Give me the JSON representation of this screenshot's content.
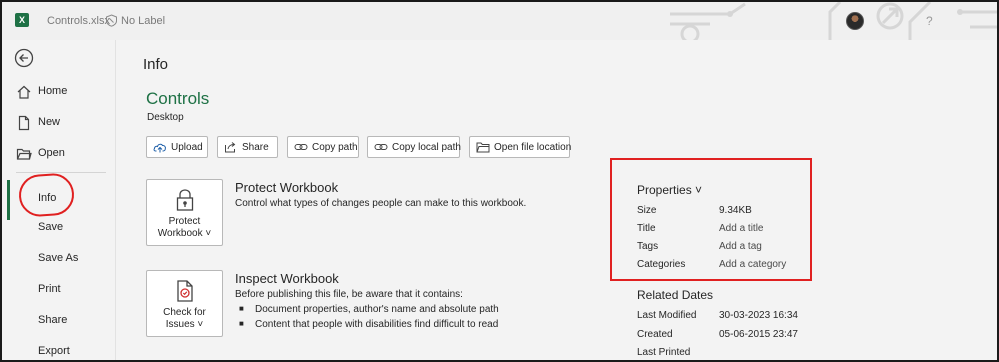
{
  "titlebar": {
    "file_name": "Controls.xlsx",
    "sensitivity_label": "No Label",
    "help": "?"
  },
  "sidebar": {
    "items": [
      {
        "label": "Home"
      },
      {
        "label": "New"
      },
      {
        "label": "Open"
      },
      {
        "label": "Info"
      },
      {
        "label": "Save"
      },
      {
        "label": "Save As"
      },
      {
        "label": "Print"
      },
      {
        "label": "Share"
      },
      {
        "label": "Export"
      }
    ]
  },
  "main": {
    "page_title": "Info",
    "file_title": "Controls",
    "file_location": "Desktop",
    "actions": [
      {
        "label": "Upload"
      },
      {
        "label": "Share"
      },
      {
        "label": "Copy path"
      },
      {
        "label": "Copy local path"
      },
      {
        "label": "Open file location"
      }
    ],
    "protect": {
      "button_line1": "Protect",
      "button_line2": "Workbook ˅",
      "title": "Protect Workbook",
      "description": "Control what types of changes people can make to this workbook."
    },
    "inspect": {
      "button_line1": "Check for",
      "button_line2": "Issues ˅",
      "title": "Inspect Workbook",
      "description": "Before publishing this file, be aware that it contains:",
      "bullets": [
        "Document properties, author's name and absolute path",
        "Content that people with disabilities find difficult to read"
      ]
    }
  },
  "properties": {
    "heading": "Properties ˅",
    "rows": [
      {
        "key": "Size",
        "value": "9.34KB"
      },
      {
        "key": "Title",
        "value": "Add a title"
      },
      {
        "key": "Tags",
        "value": "Add a tag"
      },
      {
        "key": "Categories",
        "value": "Add a category"
      }
    ]
  },
  "related_dates": {
    "heading": "Related Dates",
    "rows": [
      {
        "key": "Last Modified",
        "value": "30-03-2023 16:34"
      },
      {
        "key": "Created",
        "value": "05-06-2015 23:47"
      },
      {
        "key": "Last Printed",
        "value": ""
      }
    ]
  },
  "colors": {
    "accent": "#1e7145",
    "annotation": "#e02020"
  }
}
